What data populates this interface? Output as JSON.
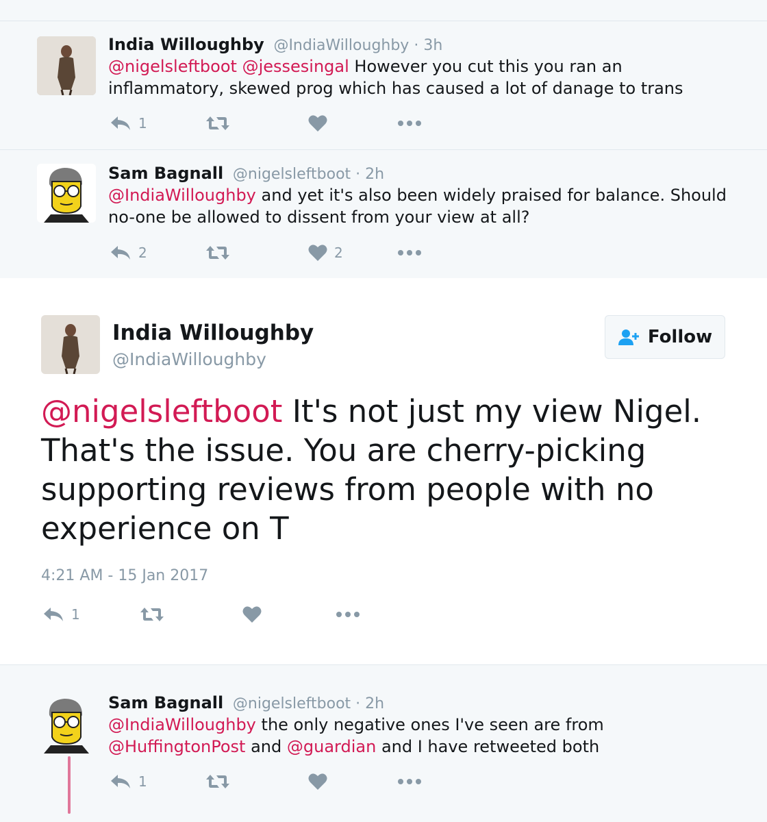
{
  "tweets": [
    {
      "name": "India Willoughby",
      "handle": "@IndiaWilloughby",
      "time": "3h",
      "mentions": [
        "@nigelsleftboot",
        "@jessesingal"
      ],
      "text_line1": "However you cut this you ran an",
      "text_line2": "inflammatory, skewed prog which has caused a lot of danage to trans",
      "reply_count": "1",
      "like_count": ""
    },
    {
      "name": "Sam Bagnall",
      "handle": "@nigelsleftboot",
      "time": "2h",
      "mention": "@IndiaWilloughby",
      "text_line1": "and yet it's also been widely praised for balance. Should",
      "text_line2": "no-one be allowed to dissent from your view at all?",
      "reply_count": "2",
      "like_count": "2"
    }
  ],
  "focus": {
    "name": "India Willoughby",
    "handle": "@IndiaWilloughby",
    "follow_label": "Follow",
    "mention": "@nigelsleftboot",
    "line1": "It's not just my view Nigel.",
    "line2": "That's the issue. You are cherry-picking",
    "line3": "supporting reviews from people with no",
    "line4": "experience on T",
    "timestamp": "4:21 AM - 15 Jan 2017",
    "reply_count": "1"
  },
  "last_reply": {
    "name": "Sam Bagnall",
    "handle": "@nigelsleftboot",
    "time": "2h",
    "mention1": "@IndiaWilloughby",
    "text1": "the only negative ones I've seen are from",
    "mention2": "@HuffingtonPost",
    "text2a": "and",
    "mention3": "@guardian",
    "text2b": "and I have retweeted both",
    "reply_count": "1"
  },
  "separator": "·",
  "colors": {
    "link": "#d21a54",
    "icon": "#8899a6",
    "thread_line": "#e0779a"
  },
  "icons": [
    "reply-icon",
    "retweet-icon",
    "heart-icon",
    "more-icon",
    "follow-person-icon"
  ]
}
